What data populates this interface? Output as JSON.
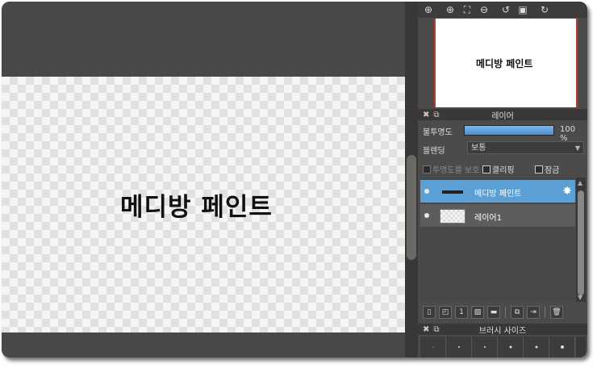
{
  "canvas": {
    "text": "메디방 페인트"
  },
  "navigator": {
    "preview_text": "메디방 페인트",
    "buttons": [
      "zoom-in-icon",
      "zoom-in-alt-icon",
      "fit-screen-icon",
      "zoom-out-icon",
      "rotate-left-icon",
      "reset-view-icon",
      "rotate-right-icon"
    ]
  },
  "layer_panel": {
    "title": "레이어",
    "opacity_label": "불투명도",
    "opacity_value": "100 %",
    "opacity_fraction": 1.0,
    "blend_label": "블렌딩",
    "blend_value": "보통",
    "protect_alpha_label": "투명도를 보호",
    "clipping_label": "클리핑",
    "lock_label": "잠금",
    "layers": [
      {
        "name": "메디방 페인트",
        "active": true
      },
      {
        "name": "레이어1",
        "active": false
      }
    ]
  },
  "brush_panel": {
    "title": "브러시 사이즈"
  },
  "colors": {
    "accent": "#5a9fd6",
    "panel": "#4d4b49",
    "canvas_bg": "#4a4846"
  }
}
